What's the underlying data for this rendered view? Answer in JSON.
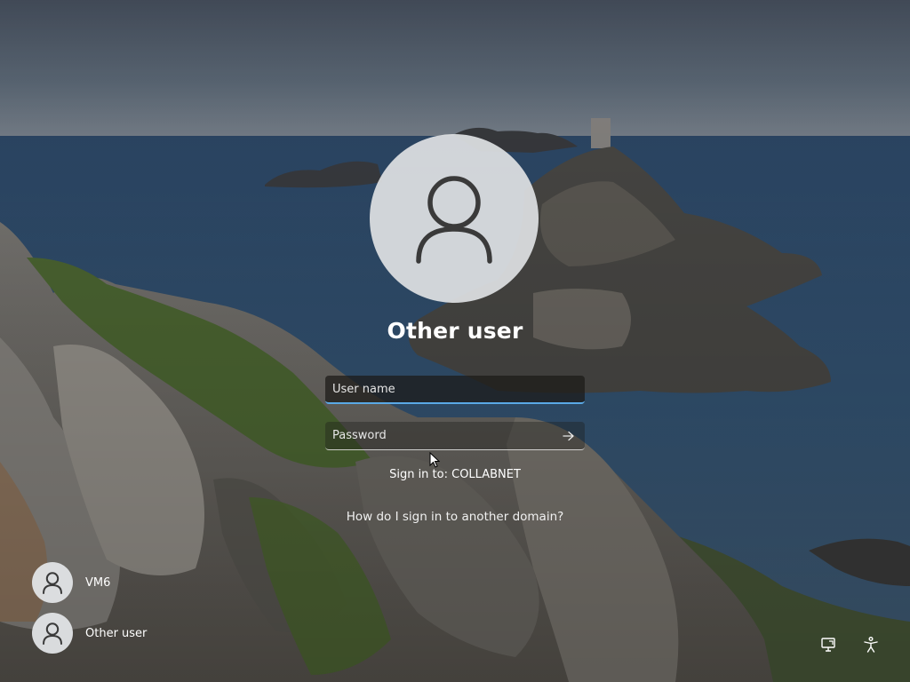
{
  "login": {
    "selected_user": "Other user",
    "username_placeholder": "User name",
    "password_placeholder": "Password",
    "sign_in_to": "Sign in to: COLLABNET",
    "help_link": "How do I sign in to another domain?",
    "submit_icon": "arrow-right-icon"
  },
  "user_list": [
    {
      "name": "VM6",
      "icon": "user-icon"
    },
    {
      "name": "Other user",
      "icon": "user-icon"
    }
  ],
  "system_tray": [
    {
      "icon": "network-icon"
    },
    {
      "icon": "accessibility-icon"
    }
  ],
  "colors": {
    "focus_accent": "#5aa9e6",
    "avatar_bg": "#dee0e2",
    "avatar_glyph": "#3a3a3a"
  }
}
